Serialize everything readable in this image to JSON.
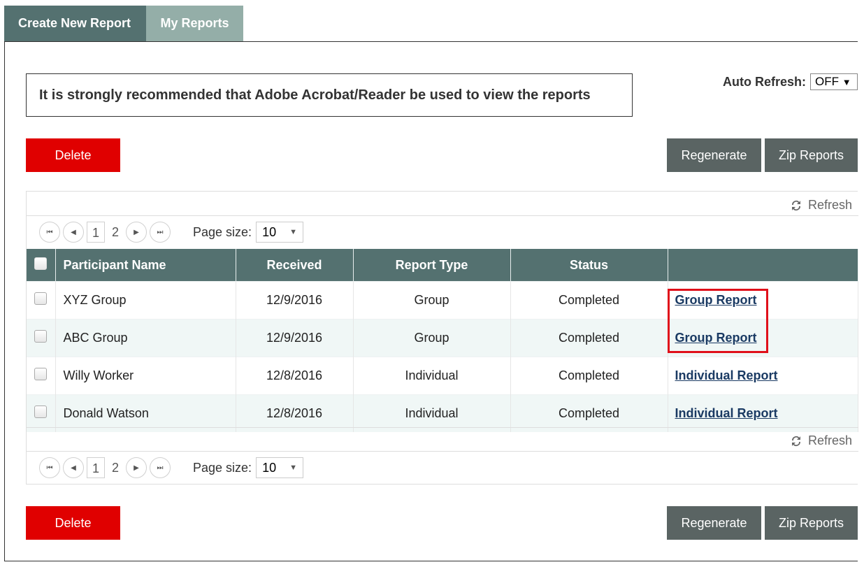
{
  "tabs": [
    {
      "label": "Create New Report",
      "active": true
    },
    {
      "label": "My Reports",
      "active": false
    }
  ],
  "notice": "It is strongly recommended that Adobe Acrobat/Reader be used to view the reports",
  "auto_refresh": {
    "label": "Auto Refresh:",
    "value": "OFF"
  },
  "actions": {
    "delete": "Delete",
    "regenerate": "Regenerate",
    "zip": "Zip Reports"
  },
  "grid": {
    "refresh_label": "Refresh",
    "pager": {
      "pages": [
        "1",
        "2"
      ],
      "current": "1",
      "page_size_label": "Page size:",
      "page_size": "10"
    },
    "columns": [
      "Participant Name",
      "Received",
      "Report Type",
      "Status",
      ""
    ],
    "rows": [
      {
        "name": "XYZ Group",
        "received": "12/9/2016",
        "type": "Group",
        "status": "Completed",
        "link": "Group Report"
      },
      {
        "name": "ABC Group",
        "received": "12/9/2016",
        "type": "Group",
        "status": "Completed",
        "link": "Group Report"
      },
      {
        "name": "Willy Worker",
        "received": "12/8/2016",
        "type": "Individual",
        "status": "Completed",
        "link": "Individual Report"
      },
      {
        "name": "Donald Watson",
        "received": "12/8/2016",
        "type": "Individual",
        "status": "Completed",
        "link": "Individual Report"
      }
    ]
  },
  "colors": {
    "header": "#547170",
    "tab_inactive": "#94aea8",
    "delete": "#e00000",
    "button": "#5a6463",
    "highlight": "#e0101a",
    "link": "#1a3a63"
  }
}
